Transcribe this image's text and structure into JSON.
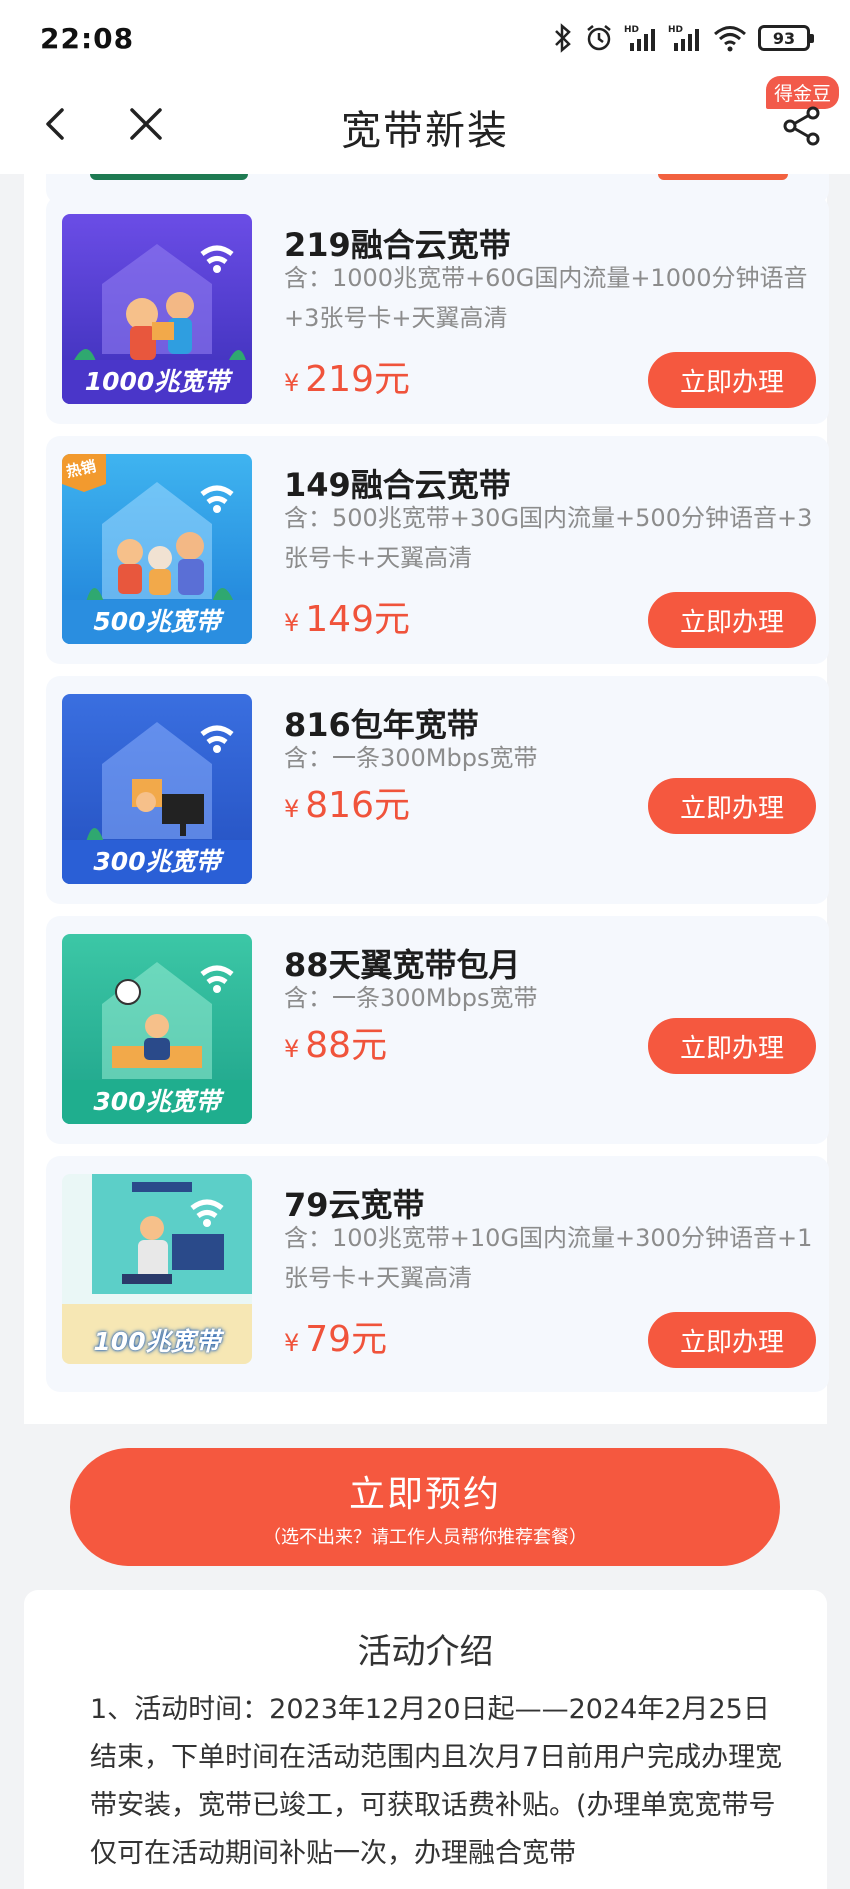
{
  "status_bar": {
    "time": "22:08",
    "battery": "93"
  },
  "nav": {
    "title": "宽带新装",
    "badge": "得金豆"
  },
  "products": [
    {
      "title": "219融合云宽带",
      "desc": "含：1000兆宽带+60G国内流量+1000分钟语音+3张号卡+天翼高清",
      "currency": "¥",
      "price": "219元",
      "button": "立即办理",
      "thumb_label": "1000兆宽带",
      "hot": ""
    },
    {
      "title": "149融合云宽带",
      "desc": "含：500兆宽带+30G国内流量+500分钟语音+3张号卡+天翼高清",
      "currency": "¥",
      "price": "149元",
      "button": "立即办理",
      "thumb_label": "500兆宽带",
      "hot": "热销"
    },
    {
      "title": "816包年宽带",
      "desc": "含：一条300Mbps宽带",
      "currency": "¥",
      "price": "816元",
      "button": "立即办理",
      "thumb_label": "300兆宽带",
      "hot": ""
    },
    {
      "title": "88天翼宽带包月",
      "desc": "含：一条300Mbps宽带",
      "currency": "¥",
      "price": "88元",
      "button": "立即办理",
      "thumb_label": "300兆宽带",
      "hot": ""
    },
    {
      "title": "79云宽带",
      "desc": "含：100兆宽带+10G国内流量+300分钟语音+1张号卡+天翼高清",
      "currency": "¥",
      "price": "79元",
      "button": "立即办理",
      "thumb_label": "100兆宽带",
      "hot": ""
    }
  ],
  "reserve": {
    "label": "立即预约",
    "sub": "（选不出来？请工作人员帮你推荐套餐）"
  },
  "intro": {
    "title": "活动介绍",
    "text": "1、活动时间：2023年12月20日起——2024年2月25日结束，下单时间在活动范围内且次月7日前用户完成办理宽带安装，宽带已竣工，可获取话费补贴。(办理单宽宽带号仅可在活动期间补贴一次，办理融合宽带"
  },
  "colors": {
    "accent": "#f5583f",
    "price": "#f0533b",
    "card_bg": "#f5f8fd"
  }
}
